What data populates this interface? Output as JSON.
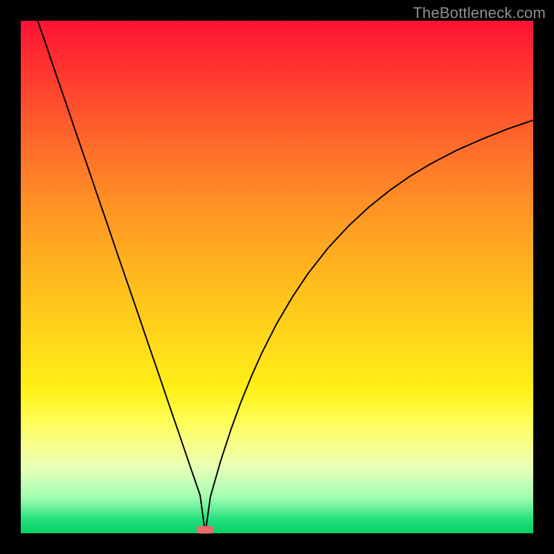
{
  "watermark": "TheBottleneck.com",
  "colors": {
    "curve": "#000000",
    "marker": "#e96b6b",
    "frame_bg": "#000000"
  },
  "chart_data": {
    "type": "line",
    "title": "",
    "xlabel": "",
    "ylabel": "",
    "xlim": [
      0,
      100
    ],
    "ylim": [
      0,
      100
    ],
    "grid": false,
    "legend": false,
    "minimum": {
      "x": 36,
      "y": 0
    },
    "series": [
      {
        "name": "curve",
        "x": [
          3.3,
          5,
          7,
          9,
          11,
          13,
          15,
          17,
          19,
          21,
          23,
          25,
          27,
          29,
          31,
          33,
          35,
          36,
          37,
          39,
          41,
          43,
          45,
          47,
          50,
          53,
          56,
          60,
          64,
          68,
          72,
          76,
          80,
          85,
          90,
          95,
          100
        ],
        "y": [
          100,
          95.1,
          89.2,
          83.4,
          77.5,
          71.7,
          65.8,
          60,
          54.1,
          48.3,
          42.5,
          36.6,
          30.8,
          24.9,
          19.1,
          13.2,
          7.4,
          0,
          7.1,
          14.1,
          20.2,
          25.7,
          30.6,
          35.1,
          41,
          46.1,
          50.6,
          55.7,
          60,
          63.7,
          66.9,
          69.7,
          72.1,
          74.7,
          76.9,
          78.9,
          80.6
        ]
      }
    ]
  }
}
